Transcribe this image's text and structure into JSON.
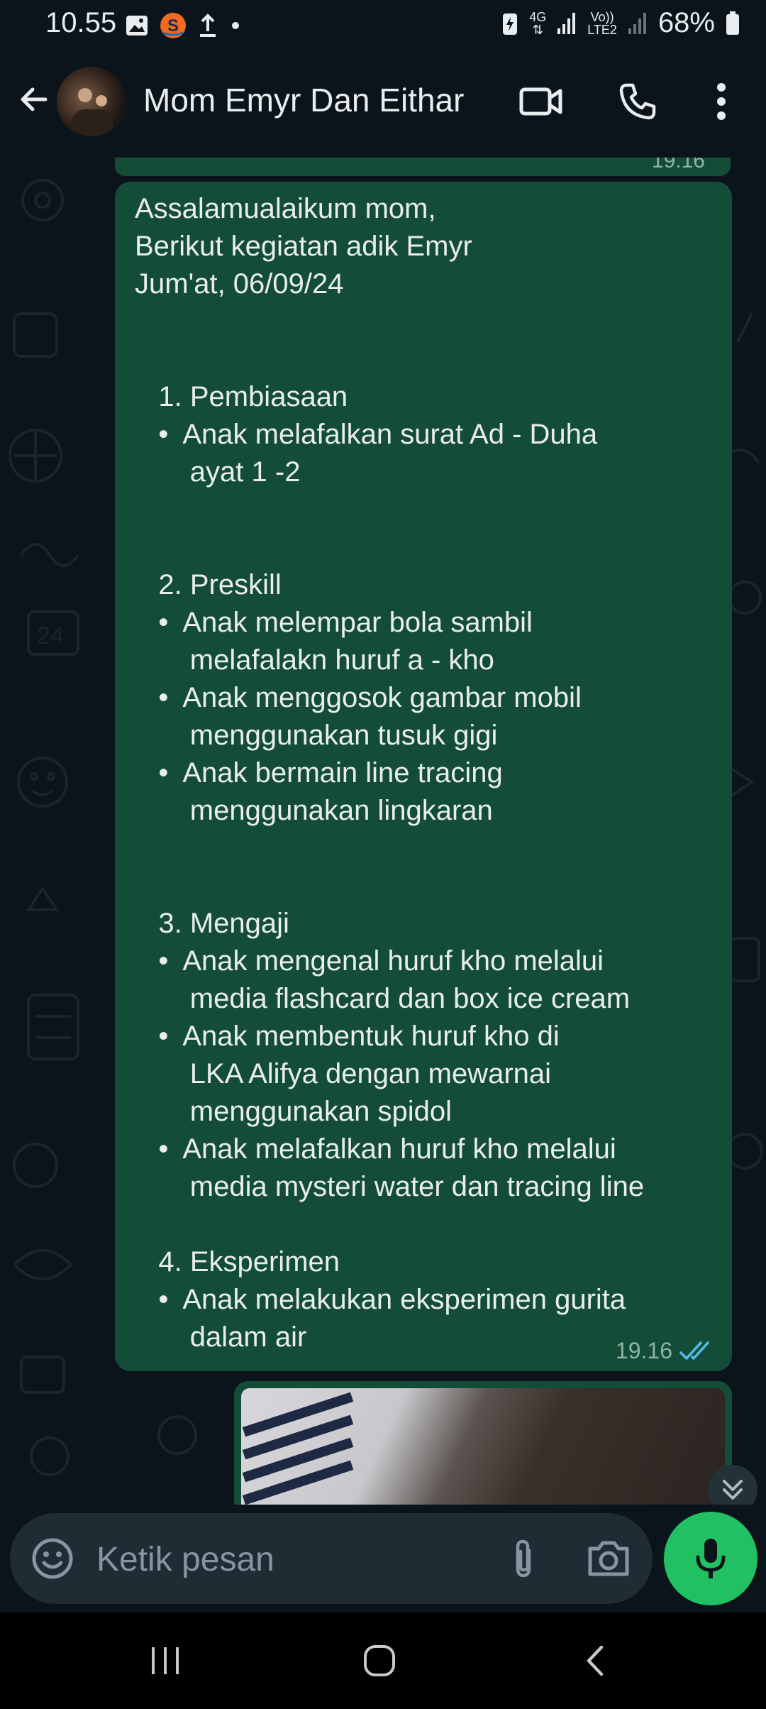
{
  "status_bar": {
    "time": "10.55",
    "network_label": "4G",
    "volte_label": "Vo))",
    "lte_label": "LTE2",
    "battery": "68%",
    "icons": [
      "image-icon",
      "shopee-icon",
      "upload-icon",
      "dot-icon",
      "battery-saver-icon",
      "signal-icon",
      "battery-icon"
    ]
  },
  "header": {
    "title": "Mom Emyr Dan Eithar",
    "icons": [
      "back-arrow-icon",
      "video-call-icon",
      "phone-icon",
      "more-vertical-icon"
    ]
  },
  "chat": {
    "previous_message_time": "19.16",
    "message": {
      "text": "Assalamualaikum mom,\nBerikut kegiatan adik Emyr\nJum'at, 06/09/24\n\n\n   1. Pembiasaan\n   •  Anak melafalkan surat Ad - Duha\n       ayat 1 -2\n\n\n   2. Preskill\n   •  Anak melempar bola sambil\n       melafalakn huruf a - kho\n   •  Anak menggosok gambar mobil\n       menggunakan tusuk gigi\n   •  Anak bermain line tracing\n       menggunakan lingkaran\n\n\n   3. Mengaji\n   •  Anak mengenal huruf kho melalui\n       media flashcard dan box ice cream\n   •  Anak membentuk huruf kho di\n       LKA Alifya dengan mewarnai\n       menggunakan spidol\n   •  Anak melafalkan huruf kho melalui\n       media mysteri water dan tracing line\n\n   4. Eksperimen\n   •  Anak melakukan eksperimen gurita\n       dalam air",
      "time": "19.16",
      "status": "read"
    },
    "colors": {
      "outgoing_bubble": "#144d37",
      "read_ticks": "#53bdeb",
      "accent_green": "#21c063"
    }
  },
  "input_bar": {
    "placeholder": "Ketik pesan",
    "icons": [
      "emoji-icon",
      "attach-icon",
      "camera-icon",
      "mic-icon"
    ]
  },
  "nav_bar": {
    "icons": [
      "recents-icon",
      "home-icon",
      "back-icon"
    ]
  }
}
